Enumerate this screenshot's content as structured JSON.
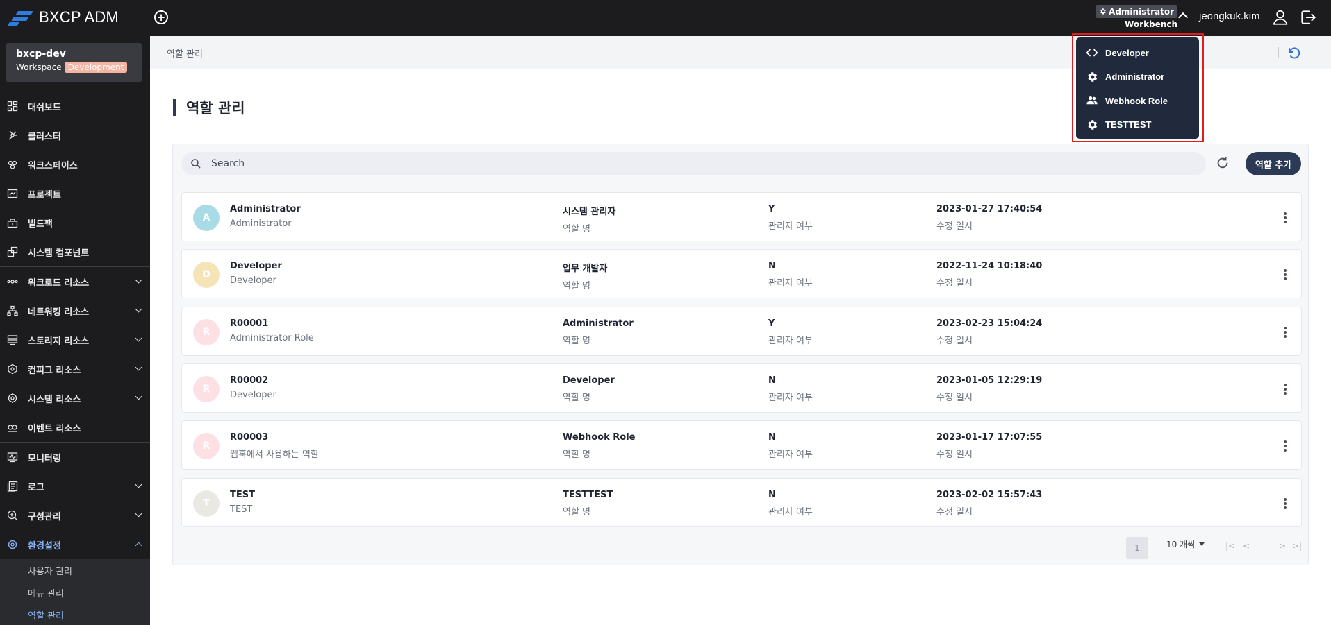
{
  "app": {
    "title": "BXCP ADM"
  },
  "topbar": {
    "role_badge": "Administrator",
    "role_sub": "Workbench",
    "username": "jeongkuk.kim"
  },
  "workspace": {
    "name": "bxcp-dev",
    "label": "Workspace",
    "tag": "Development",
    "tag_color": "#f6b4a2"
  },
  "sidebar": {
    "items": [
      {
        "label": "대쉬보드",
        "icon": "dashboard-icon",
        "chevron": false
      },
      {
        "label": "클러스터",
        "icon": "cluster-icon",
        "chevron": false
      },
      {
        "label": "워크스페이스",
        "icon": "workspace-icon",
        "chevron": false
      },
      {
        "label": "프로젝트",
        "icon": "project-icon",
        "chevron": false
      },
      {
        "label": "빌드팩",
        "icon": "buildpack-icon",
        "chevron": false
      },
      {
        "label": "시스템 컴포넌트",
        "icon": "component-icon",
        "chevron": false
      },
      {
        "label": "워크로드 리소스",
        "icon": "workload-icon",
        "chevron": true
      },
      {
        "label": "네트워킹 리소스",
        "icon": "network-icon",
        "chevron": true
      },
      {
        "label": "스토리지 리소스",
        "icon": "storage-icon",
        "chevron": true
      },
      {
        "label": "컨피그 리소스",
        "icon": "config-icon",
        "chevron": true
      },
      {
        "label": "시스템 리소스",
        "icon": "system-icon",
        "chevron": true
      },
      {
        "label": "이벤트 리소스",
        "icon": "event-icon",
        "chevron": false
      },
      {
        "label": "모니터링",
        "icon": "monitoring-icon",
        "chevron": false
      },
      {
        "label": "로그",
        "icon": "log-icon",
        "chevron": true
      },
      {
        "label": "구성관리",
        "icon": "config-search-icon",
        "chevron": true
      },
      {
        "label": "환경설정",
        "icon": "settings-icon",
        "chevron": true
      }
    ],
    "sub_items": [
      "사용자 관리",
      "메뉴 관리",
      "역할 관리"
    ]
  },
  "breadcrumb": "역할 관리",
  "page": {
    "title": "역할 관리"
  },
  "search": {
    "placeholder": "Search"
  },
  "actions": {
    "add_role": "역할 추가"
  },
  "roles": [
    {
      "avatar": "A",
      "avatar_color": "#a9dbe6",
      "id": "Administrator",
      "name_sub": "Administrator",
      "desc": "시스템 관리자",
      "desc_label": "역할 명",
      "admin": "Y",
      "admin_label": "관리자 여부",
      "modified": "2023-01-27 17:40:54",
      "modified_label": "수정 일시"
    },
    {
      "avatar": "D",
      "avatar_color": "#f4e4b6",
      "id": "Developer",
      "name_sub": "Developer",
      "desc": "업무 개발자",
      "desc_label": "역할 명",
      "admin": "N",
      "admin_label": "관리자 여부",
      "modified": "2022-11-24 10:18:40",
      "modified_label": "수정 일시"
    },
    {
      "avatar": "R",
      "avatar_color": "#fde0e4",
      "id": "R00001",
      "name_sub": "Administrator Role",
      "desc": "Administrator",
      "desc_label": "역할 명",
      "admin": "Y",
      "admin_label": "관리자 여부",
      "modified": "2023-02-23 15:04:24",
      "modified_label": "수정 일시"
    },
    {
      "avatar": "R",
      "avatar_color": "#fde0e4",
      "id": "R00002",
      "name_sub": "Developer",
      "desc": "Developer",
      "desc_label": "역할 명",
      "admin": "N",
      "admin_label": "관리자 여부",
      "modified": "2023-01-05 12:29:19",
      "modified_label": "수정 일시"
    },
    {
      "avatar": "R",
      "avatar_color": "#fde0e4",
      "id": "R00003",
      "name_sub": "웹훅에서 사용하는 역할",
      "desc": "Webhook Role",
      "desc_label": "역할 명",
      "admin": "N",
      "admin_label": "관리자 여부",
      "modified": "2023-01-17 17:07:55",
      "modified_label": "수정 일시"
    },
    {
      "avatar": "T",
      "avatar_color": "#eae8e3",
      "id": "TEST",
      "name_sub": "TEST",
      "desc": "TESTTEST",
      "desc_label": "역할 명",
      "admin": "N",
      "admin_label": "관리자 여부",
      "modified": "2023-02-02 15:57:43",
      "modified_label": "수정 일시"
    }
  ],
  "pagination": {
    "per_page": "10 개씩",
    "current": "1"
  },
  "role_dropdown": [
    {
      "label": "Developer",
      "icon": "code-icon"
    },
    {
      "label": "Administrator",
      "icon": "gear-icon"
    },
    {
      "label": "Webhook Role",
      "icon": "people-icon"
    },
    {
      "label": "TESTTEST",
      "icon": "gear-icon"
    }
  ],
  "colors": {
    "accent": "#2c3a56",
    "highlight": "#e01e1e",
    "active_nav": "#8ab4f8"
  }
}
